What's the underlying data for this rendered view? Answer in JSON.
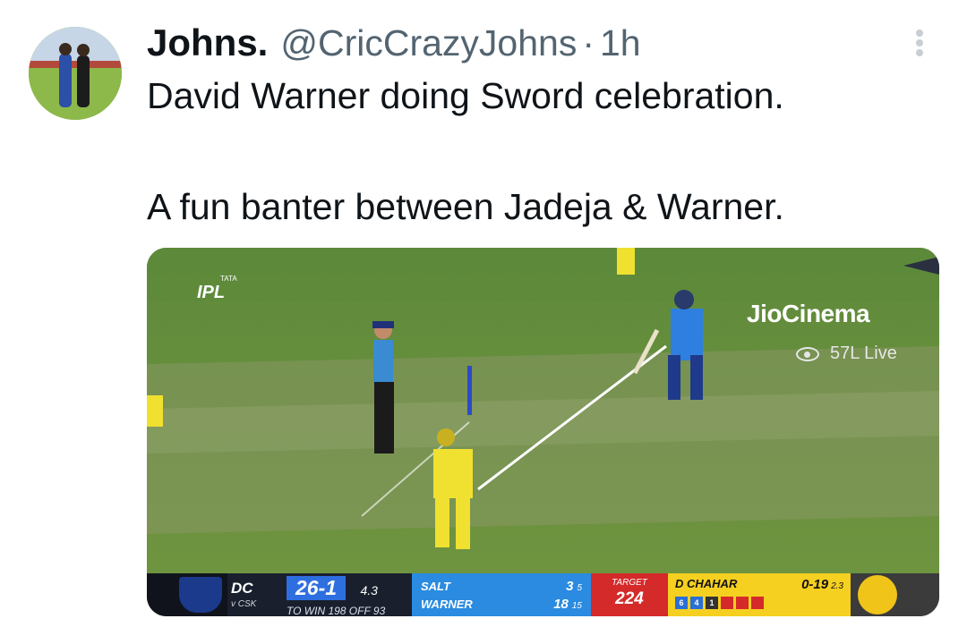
{
  "tweet": {
    "author_name": "Johns.",
    "author_handle": "@CricCrazyJohns",
    "separator": "·",
    "time_ago": "1h",
    "text_line_1": "David Warner doing Sword celebration.",
    "text_line_2": "A fun banter between Jadeja & Warner."
  },
  "media": {
    "broadcaster": "JioCinema",
    "viewers": "57L Live",
    "league_tata": "TATA",
    "league_name": "IPL",
    "scorebar": {
      "batting_team": "DC",
      "vs_team": "v CSK",
      "score": "26-1",
      "overs": "4.3",
      "requirement": "TO WIN 198 OFF 93",
      "batter_1_name": "SALT",
      "batter_1_runs": "3",
      "batter_1_balls": "5",
      "batter_2_name": "WARNER",
      "batter_2_runs": "18",
      "batter_2_balls": "15",
      "target_label": "TARGET",
      "target_value": "224",
      "bowler_name": "D CHAHAR",
      "bowler_figures": "0-19",
      "bowler_overs": "2.3",
      "this_over": [
        "6",
        "4",
        "1",
        "",
        "",
        ""
      ]
    }
  },
  "colors": {
    "text_primary": "#0f1419",
    "text_secondary": "#536471",
    "pitch_green": "#6a8a3a",
    "dc_blue": "#2a8be0",
    "target_red": "#d42a2a",
    "bowler_yellow": "#f5d020"
  },
  "icons": {
    "more": "more-vertical-icon",
    "eye": "eye-icon"
  }
}
